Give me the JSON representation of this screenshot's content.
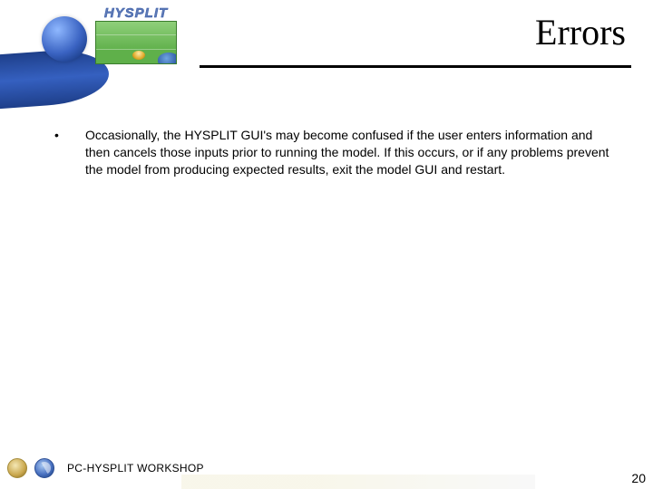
{
  "header": {
    "product_name": "HYSPLIT",
    "slide_title": "Errors"
  },
  "content": {
    "bullets": [
      "Occasionally, the HYSPLIT GUI's may become confused if the user enters information and then cancels those inputs prior to running the model.  If this occurs, or if any problems prevent the model from producing expected results, exit the model GUI and restart."
    ]
  },
  "footer": {
    "workshop_label": "PC-HYSPLIT WORKSHOP",
    "page_number": "20"
  }
}
